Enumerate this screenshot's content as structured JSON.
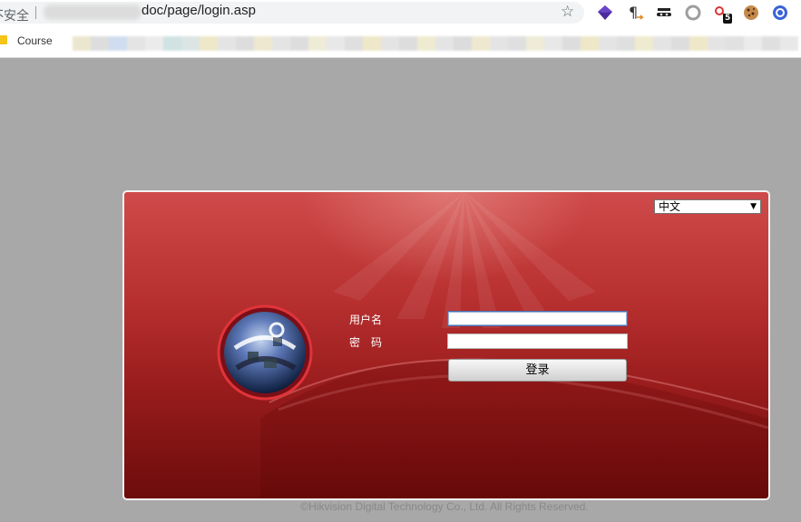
{
  "browser": {
    "security_label": "不安全",
    "url": "doc/page/login.asp",
    "bookmark_label": "Course",
    "extension_badge": "5",
    "icons": [
      "star-icon",
      "purple-gem-extension-icon",
      "pilcrow-extension-icon",
      "incognito-extension-icon",
      "circle-extension-icon",
      "key-extension-icon",
      "cookie-extension-icon",
      "profile-extension-icon",
      "folder-icon"
    ]
  },
  "login": {
    "language_selected": "中文",
    "username_label": "用户名",
    "password_label": "密　码",
    "login_button": "登录",
    "username_value": "",
    "password_value": ""
  },
  "footer": {
    "copyright": "©Hikvision Digital Technology Co., Ltd. All Rights Reserved."
  },
  "colors": {
    "page_background": "#a8a8a8",
    "panel_red": "#b83030",
    "panel_dark_red": "#6d0c0c"
  }
}
